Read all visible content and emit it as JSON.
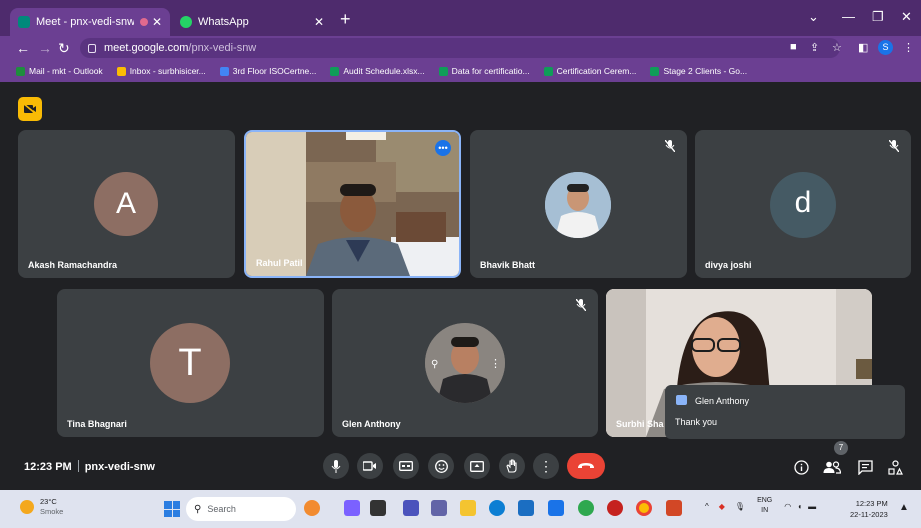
{
  "browser": {
    "tabs": [
      {
        "title": "Meet - pnx-vedi-snw",
        "active": true
      },
      {
        "title": "WhatsApp",
        "active": false
      }
    ],
    "url_host": "meet.google.com",
    "url_path": "/pnx-vedi-snw",
    "profile_initial": "S",
    "bookmarks": [
      {
        "label": "Mail - mkt - Outlook",
        "color": "#1e8e3e"
      },
      {
        "label": "Inbox - surbhisicer...",
        "color": "#fbbc04"
      },
      {
        "label": "3rd Floor ISOCertne...",
        "color": "#4285f4"
      },
      {
        "label": "Audit Schedule.xlsx...",
        "color": "#0f9d58"
      },
      {
        "label": "Data for certificatio...",
        "color": "#0f9d58"
      },
      {
        "label": "Certification Cerem...",
        "color": "#0f9d58"
      },
      {
        "label": "Stage 2 Clients - Go...",
        "color": "#0f9d58"
      }
    ]
  },
  "meet": {
    "participants": [
      {
        "name": "Akash Ramachandra",
        "initial": "A",
        "avatar_color": "#8d6e63",
        "type": "initial",
        "muted": false
      },
      {
        "name": "Rahul Patil",
        "type": "video",
        "muted": false,
        "speaking": true
      },
      {
        "name": "Bhavik Bhatt",
        "type": "photo",
        "muted": true
      },
      {
        "name": "divya joshi",
        "initial": "d",
        "avatar_color": "#455a64",
        "type": "initial",
        "muted": true
      },
      {
        "name": "Tina Bhagnari",
        "initial": "T",
        "avatar_color": "#8d6e63",
        "type": "initial",
        "muted": false
      },
      {
        "name": "Glen Anthony",
        "type": "photo",
        "muted": true
      },
      {
        "name": "Surbhi Sha",
        "type": "video",
        "muted": false
      }
    ],
    "chat_toast": {
      "sender": "Glen Anthony",
      "message": "Thank you"
    },
    "time": "12:23 PM",
    "meeting_code": "pnx-vedi-snw",
    "people_count": "7"
  },
  "taskbar": {
    "weather_temp": "23°C",
    "weather_desc": "Smoke",
    "search_placeholder": "Search",
    "lang_line1": "ENG",
    "lang_line2": "IN",
    "clock_time": "12:23 PM",
    "clock_date": "22-11-2023"
  }
}
